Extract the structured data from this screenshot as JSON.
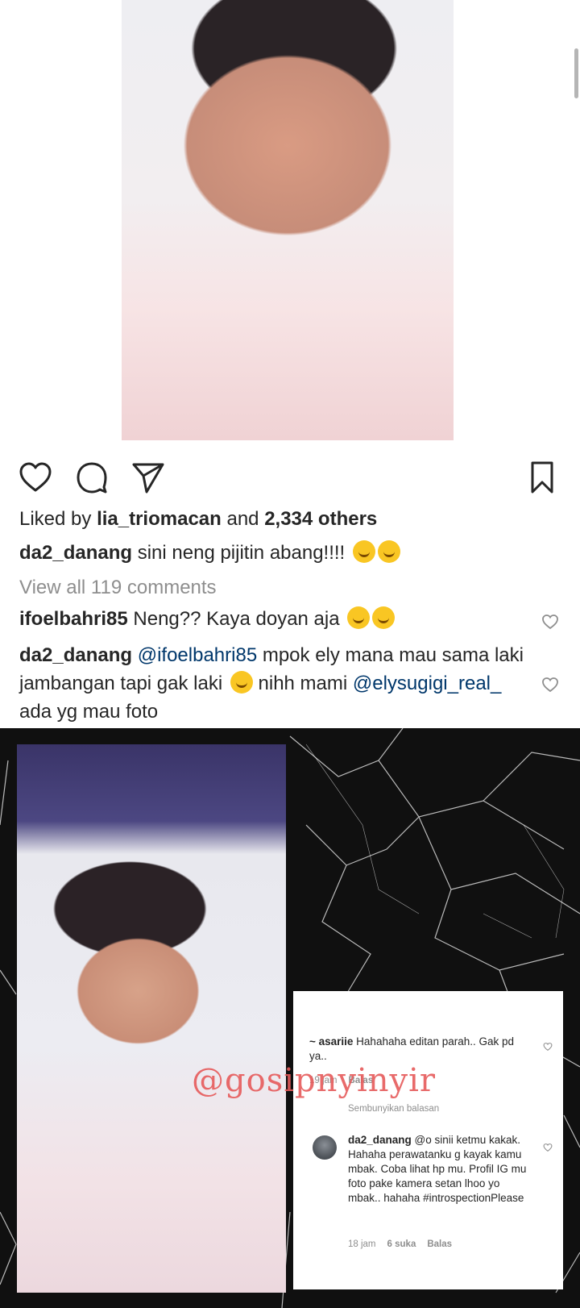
{
  "post": {
    "likes_prefix": "Liked by ",
    "likes_user": "lia_triomacan",
    "likes_and": " and ",
    "likes_count": "2,334 others",
    "caption_user": "da2_danang",
    "caption_text": " sini neng pijitin abang!!!!",
    "view_all": "View all 119 comments",
    "comments": [
      {
        "user": "ifoelbahri85",
        "text": " Neng?? Kaya doyan aja"
      },
      {
        "user": "da2_danang",
        "mention": " @ifoelbahri85",
        "text": " mpok ely mana mau sama laki jambangan tapi gak laki",
        "text2": " nihh mami ",
        "mention2": "@elysugigi_real_",
        "text3": " ada yg mau foto"
      }
    ]
  },
  "icons": {
    "like": "heart-outline-icon",
    "comment": "speech-bubble-icon",
    "share": "paper-plane-icon",
    "save": "bookmark-icon"
  },
  "collage": {
    "watermark": "@gosipnyinyir",
    "card": {
      "comment1_user": "~ asariie",
      "comment1_text": " Hahahaha editan parah.. Gak pd ya..",
      "comment1_time": "19 jam",
      "comment1_reply": "Balas",
      "hide_replies": "Sembunyikan balasan",
      "comment2_user": "da2_danang",
      "comment2_mention": " @o",
      "comment2_text": " sinii ketmu kakak. Hahaha perawatanku g kayak kamu mbak. Coba lihat hp mu. Profil IG mu foto pake kamera setan lhoo yo mbak.. hahaha #introspectionPlease",
      "comment2_time": "18 jam",
      "comment2_likes": "6 suka",
      "comment2_reply": "Balas"
    }
  },
  "colors": {
    "text": "#262626",
    "muted": "#8e8e8e",
    "mention": "#00376b",
    "watermark": "#e65a5a"
  }
}
